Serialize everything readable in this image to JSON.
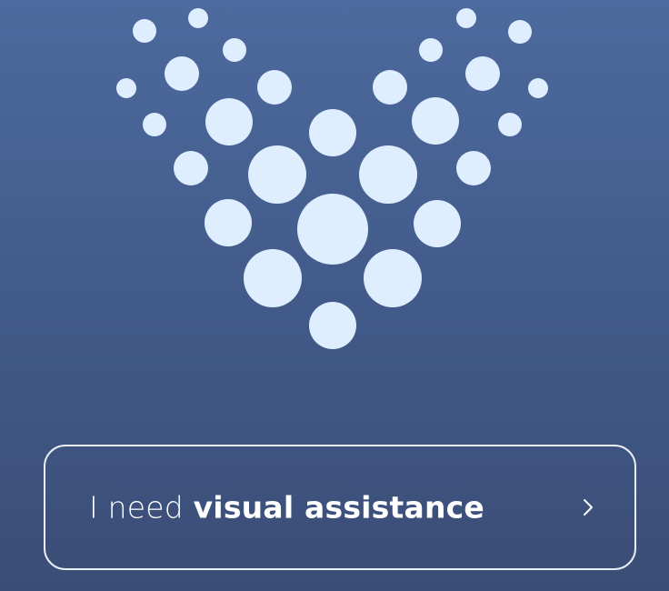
{
  "button": {
    "prefix": "I need ",
    "emphasis": "visual assistance",
    "icon": "chevron-right-icon"
  },
  "colors": {
    "background_top": "#4d6a9e",
    "background_bottom": "#3a4d76",
    "dot": "#deeefe",
    "button_border": "#e9eef7",
    "text": "#ffffff"
  }
}
